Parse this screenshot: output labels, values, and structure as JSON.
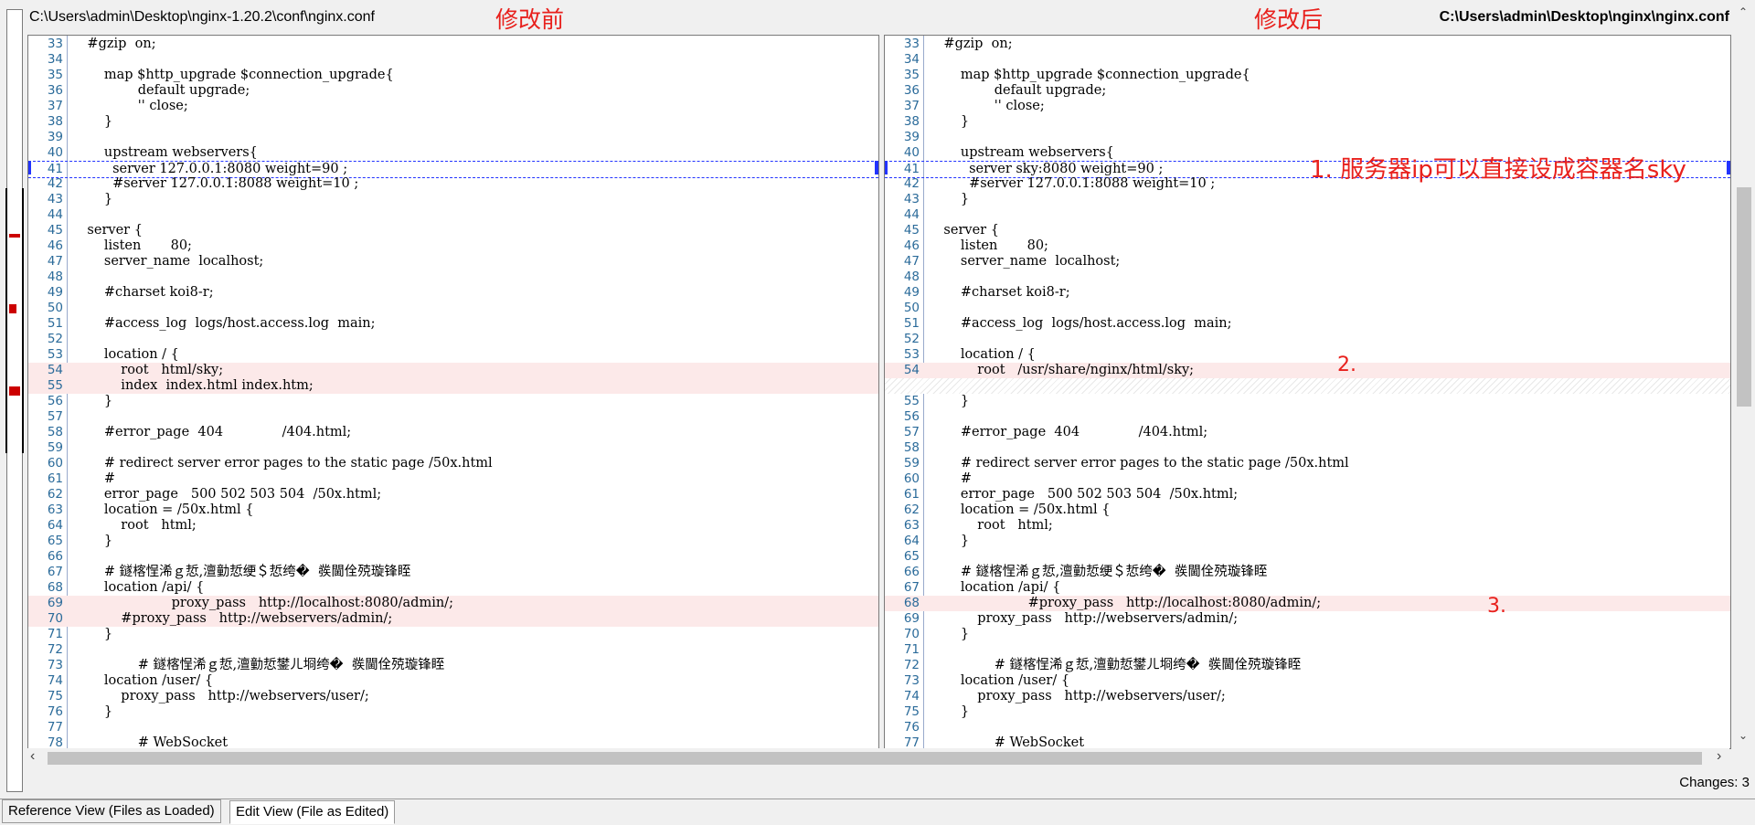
{
  "left": {
    "path": "C:\\Users\\admin\\Desktop\\nginx-1.20.2\\conf\\nginx.conf",
    "label": "修改前",
    "lines": [
      {
        "n": "33",
        "t": "    #gzip  on;"
      },
      {
        "n": "34",
        "t": ""
      },
      {
        "n": "35",
        "t": "        map $http_upgrade $connection_upgrade{"
      },
      {
        "n": "36",
        "t": "                default upgrade;"
      },
      {
        "n": "37",
        "t": "                '' close;"
      },
      {
        "n": "38",
        "t": "        }"
      },
      {
        "n": "39",
        "t": ""
      },
      {
        "n": "40",
        "t": "        upstream webservers{"
      },
      {
        "n": "41",
        "t": "          server 127.0.0.1:8080 weight=90 ;"
      },
      {
        "n": "42",
        "t": "          #server 127.0.0.1:8088 weight=10 ;"
      },
      {
        "n": "43",
        "t": "        }"
      },
      {
        "n": "44",
        "t": ""
      },
      {
        "n": "45",
        "t": "    server {"
      },
      {
        "n": "46",
        "t": "        listen       80;"
      },
      {
        "n": "47",
        "t": "        server_name  localhost;"
      },
      {
        "n": "48",
        "t": ""
      },
      {
        "n": "49",
        "t": "        #charset koi8-r;"
      },
      {
        "n": "50",
        "t": ""
      },
      {
        "n": "51",
        "t": "        #access_log  logs/host.access.log  main;"
      },
      {
        "n": "52",
        "t": ""
      },
      {
        "n": "53",
        "t": "        location / {"
      },
      {
        "n": "54",
        "t": "            root   html/sky;"
      },
      {
        "n": "55",
        "t": "            index  index.html index.htm;"
      },
      {
        "n": "56",
        "t": "        }"
      },
      {
        "n": "57",
        "t": ""
      },
      {
        "n": "58",
        "t": "        #error_page  404              /404.html;"
      },
      {
        "n": "59",
        "t": ""
      },
      {
        "n": "60",
        "t": "        # redirect server error pages to the static page /50x.html"
      },
      {
        "n": "61",
        "t": "        #"
      },
      {
        "n": "62",
        "t": "        error_page   500 502 503 504  /50x.html;"
      },
      {
        "n": "63",
        "t": "        location = /50x.html {"
      },
      {
        "n": "64",
        "t": "            root   html;"
      },
      {
        "n": "65",
        "t": "        }"
      },
      {
        "n": "66",
        "t": ""
      },
      {
        "n": "67",
        "t": "        # 鐩楁悜浠ｇ悊,澶勭悊绠＄悊绔�  彂閫佺殑璇锋眰"
      },
      {
        "n": "68",
        "t": "        location /api/ {"
      },
      {
        "n": "69",
        "t": "                        proxy_pass   http://localhost:8080/admin/;"
      },
      {
        "n": "70",
        "t": "            #proxy_pass   http://webservers/admin/;"
      },
      {
        "n": "71",
        "t": "        }"
      },
      {
        "n": "72",
        "t": ""
      },
      {
        "n": "73",
        "t": "                # 鐩楁悜浠ｇ悊,澶勭悊鐢ㄦ埛绔�  彂閫佺殑璇锋眰"
      },
      {
        "n": "74",
        "t": "        location /user/ {"
      },
      {
        "n": "75",
        "t": "            proxy_pass   http://webservers/user/;"
      },
      {
        "n": "76",
        "t": "        }"
      },
      {
        "n": "77",
        "t": ""
      },
      {
        "n": "78",
        "t": "                # WebSocket"
      }
    ]
  },
  "right": {
    "path": "C:\\Users\\admin\\Desktop\\nginx\\nginx.conf",
    "label": "修改后",
    "lines": [
      {
        "n": "33",
        "t": "    #gzip  on;"
      },
      {
        "n": "34",
        "t": ""
      },
      {
        "n": "35",
        "t": "        map $http_upgrade $connection_upgrade{"
      },
      {
        "n": "36",
        "t": "                default upgrade;"
      },
      {
        "n": "37",
        "t": "                '' close;"
      },
      {
        "n": "38",
        "t": "        }"
      },
      {
        "n": "39",
        "t": ""
      },
      {
        "n": "40",
        "t": "        upstream webservers{"
      },
      {
        "n": "41",
        "t": "          server sky:8080 weight=90 ;"
      },
      {
        "n": "42",
        "t": "          #server 127.0.0.1:8088 weight=10 ;"
      },
      {
        "n": "43",
        "t": "        }"
      },
      {
        "n": "44",
        "t": ""
      },
      {
        "n": "45",
        "t": "    server {"
      },
      {
        "n": "46",
        "t": "        listen       80;"
      },
      {
        "n": "47",
        "t": "        server_name  localhost;"
      },
      {
        "n": "48",
        "t": ""
      },
      {
        "n": "49",
        "t": "        #charset koi8-r;"
      },
      {
        "n": "50",
        "t": ""
      },
      {
        "n": "51",
        "t": "        #access_log  logs/host.access.log  main;"
      },
      {
        "n": "52",
        "t": ""
      },
      {
        "n": "53",
        "t": "        location / {"
      },
      {
        "n": "54",
        "t": "            root   /usr/share/nginx/html/sky;"
      },
      {
        "n": "",
        "t": ""
      },
      {
        "n": "55",
        "t": "        }"
      },
      {
        "n": "56",
        "t": ""
      },
      {
        "n": "57",
        "t": "        #error_page  404              /404.html;"
      },
      {
        "n": "58",
        "t": ""
      },
      {
        "n": "59",
        "t": "        # redirect server error pages to the static page /50x.html"
      },
      {
        "n": "60",
        "t": "        #"
      },
      {
        "n": "61",
        "t": "        error_page   500 502 503 504  /50x.html;"
      },
      {
        "n": "62",
        "t": "        location = /50x.html {"
      },
      {
        "n": "63",
        "t": "            root   html;"
      },
      {
        "n": "64",
        "t": "        }"
      },
      {
        "n": "65",
        "t": ""
      },
      {
        "n": "66",
        "t": "        # 鐩楁悜浠ｇ悊,澶勭悊绠＄悊绔�  彂閫佺殑璇锋眰"
      },
      {
        "n": "67",
        "t": "        location /api/ {"
      },
      {
        "n": "68",
        "t": "                        #proxy_pass   http://localhost:8080/admin/;"
      },
      {
        "n": "69",
        "t": "            proxy_pass   http://webservers/admin/;"
      },
      {
        "n": "70",
        "t": "        }"
      },
      {
        "n": "71",
        "t": ""
      },
      {
        "n": "72",
        "t": "                # 鐩楁悜浠ｇ悊,澶勭悊鐢ㄦ埛绔�  彂閫佺殑璇锋眰"
      },
      {
        "n": "73",
        "t": "        location /user/ {"
      },
      {
        "n": "74",
        "t": "            proxy_pass   http://webservers/user/;"
      },
      {
        "n": "75",
        "t": "        }"
      },
      {
        "n": "76",
        "t": ""
      },
      {
        "n": "77",
        "t": "                # WebSocket"
      }
    ]
  },
  "annotations": {
    "a1": "1. 服务器ip可以直接设成容器名sky",
    "a2": "2.",
    "a3": "3."
  },
  "tabs": {
    "reference": "Reference View (Files as Loaded)",
    "edit": "Edit View (File as Edited)"
  },
  "status": {
    "changes": "Changes: 3"
  },
  "colors": {
    "accent_red": "#e8201c",
    "changed_bg": "#fce9e9",
    "line_number": "#2b6b9a",
    "selection": "#2233ff"
  }
}
